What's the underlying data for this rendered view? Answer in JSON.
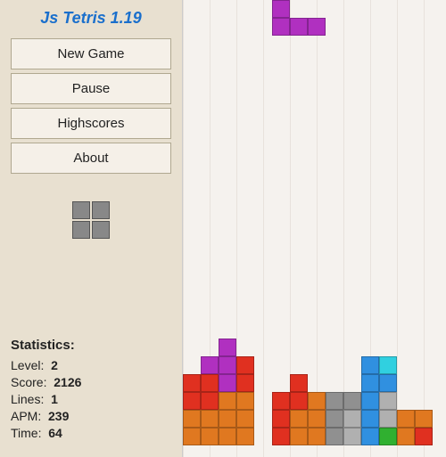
{
  "app": {
    "title": "Js Tetris 1.19"
  },
  "menu": {
    "items": [
      {
        "id": "new-game",
        "label": "New Game"
      },
      {
        "id": "pause",
        "label": "Pause"
      },
      {
        "id": "highscores",
        "label": "Highscores"
      },
      {
        "id": "about",
        "label": "About"
      }
    ]
  },
  "stats": {
    "title": "Statistics:",
    "level_label": "Level:",
    "level_val": "2",
    "score_label": "Score:",
    "score_val": "2126",
    "lines_label": "Lines:",
    "lines_val": "1",
    "apm_label": "APM:",
    "apm_val": "239",
    "time_label": "Time:",
    "time_val": "64"
  }
}
